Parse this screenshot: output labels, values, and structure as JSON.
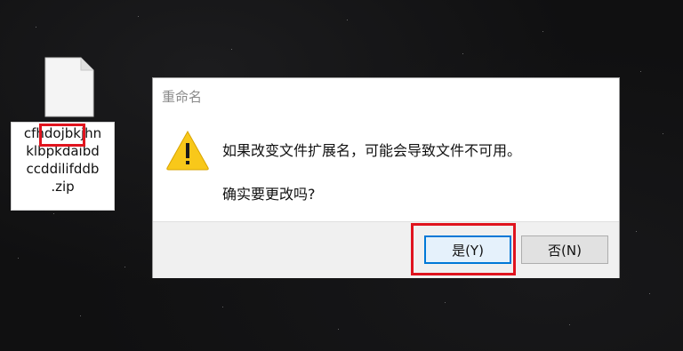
{
  "desktop": {
    "file": {
      "icon": "file-icon",
      "name_lines": [
        "cfhdojbkjhn",
        "klbpkdaibd",
        "ccddilifddb",
        ".zip"
      ],
      "highlighted_extension": ".zip"
    }
  },
  "dialog": {
    "title": "重命名",
    "icon": "warning-icon",
    "message": "如果改变文件扩展名，可能会导致文件不可用。",
    "question": "确实要更改吗?",
    "buttons": {
      "yes_label": "是(Y)",
      "no_label": "否(N)"
    }
  },
  "colors": {
    "highlight": "#e0141e",
    "focus_border": "#0078d7",
    "warning_fill": "#f8c81a"
  }
}
